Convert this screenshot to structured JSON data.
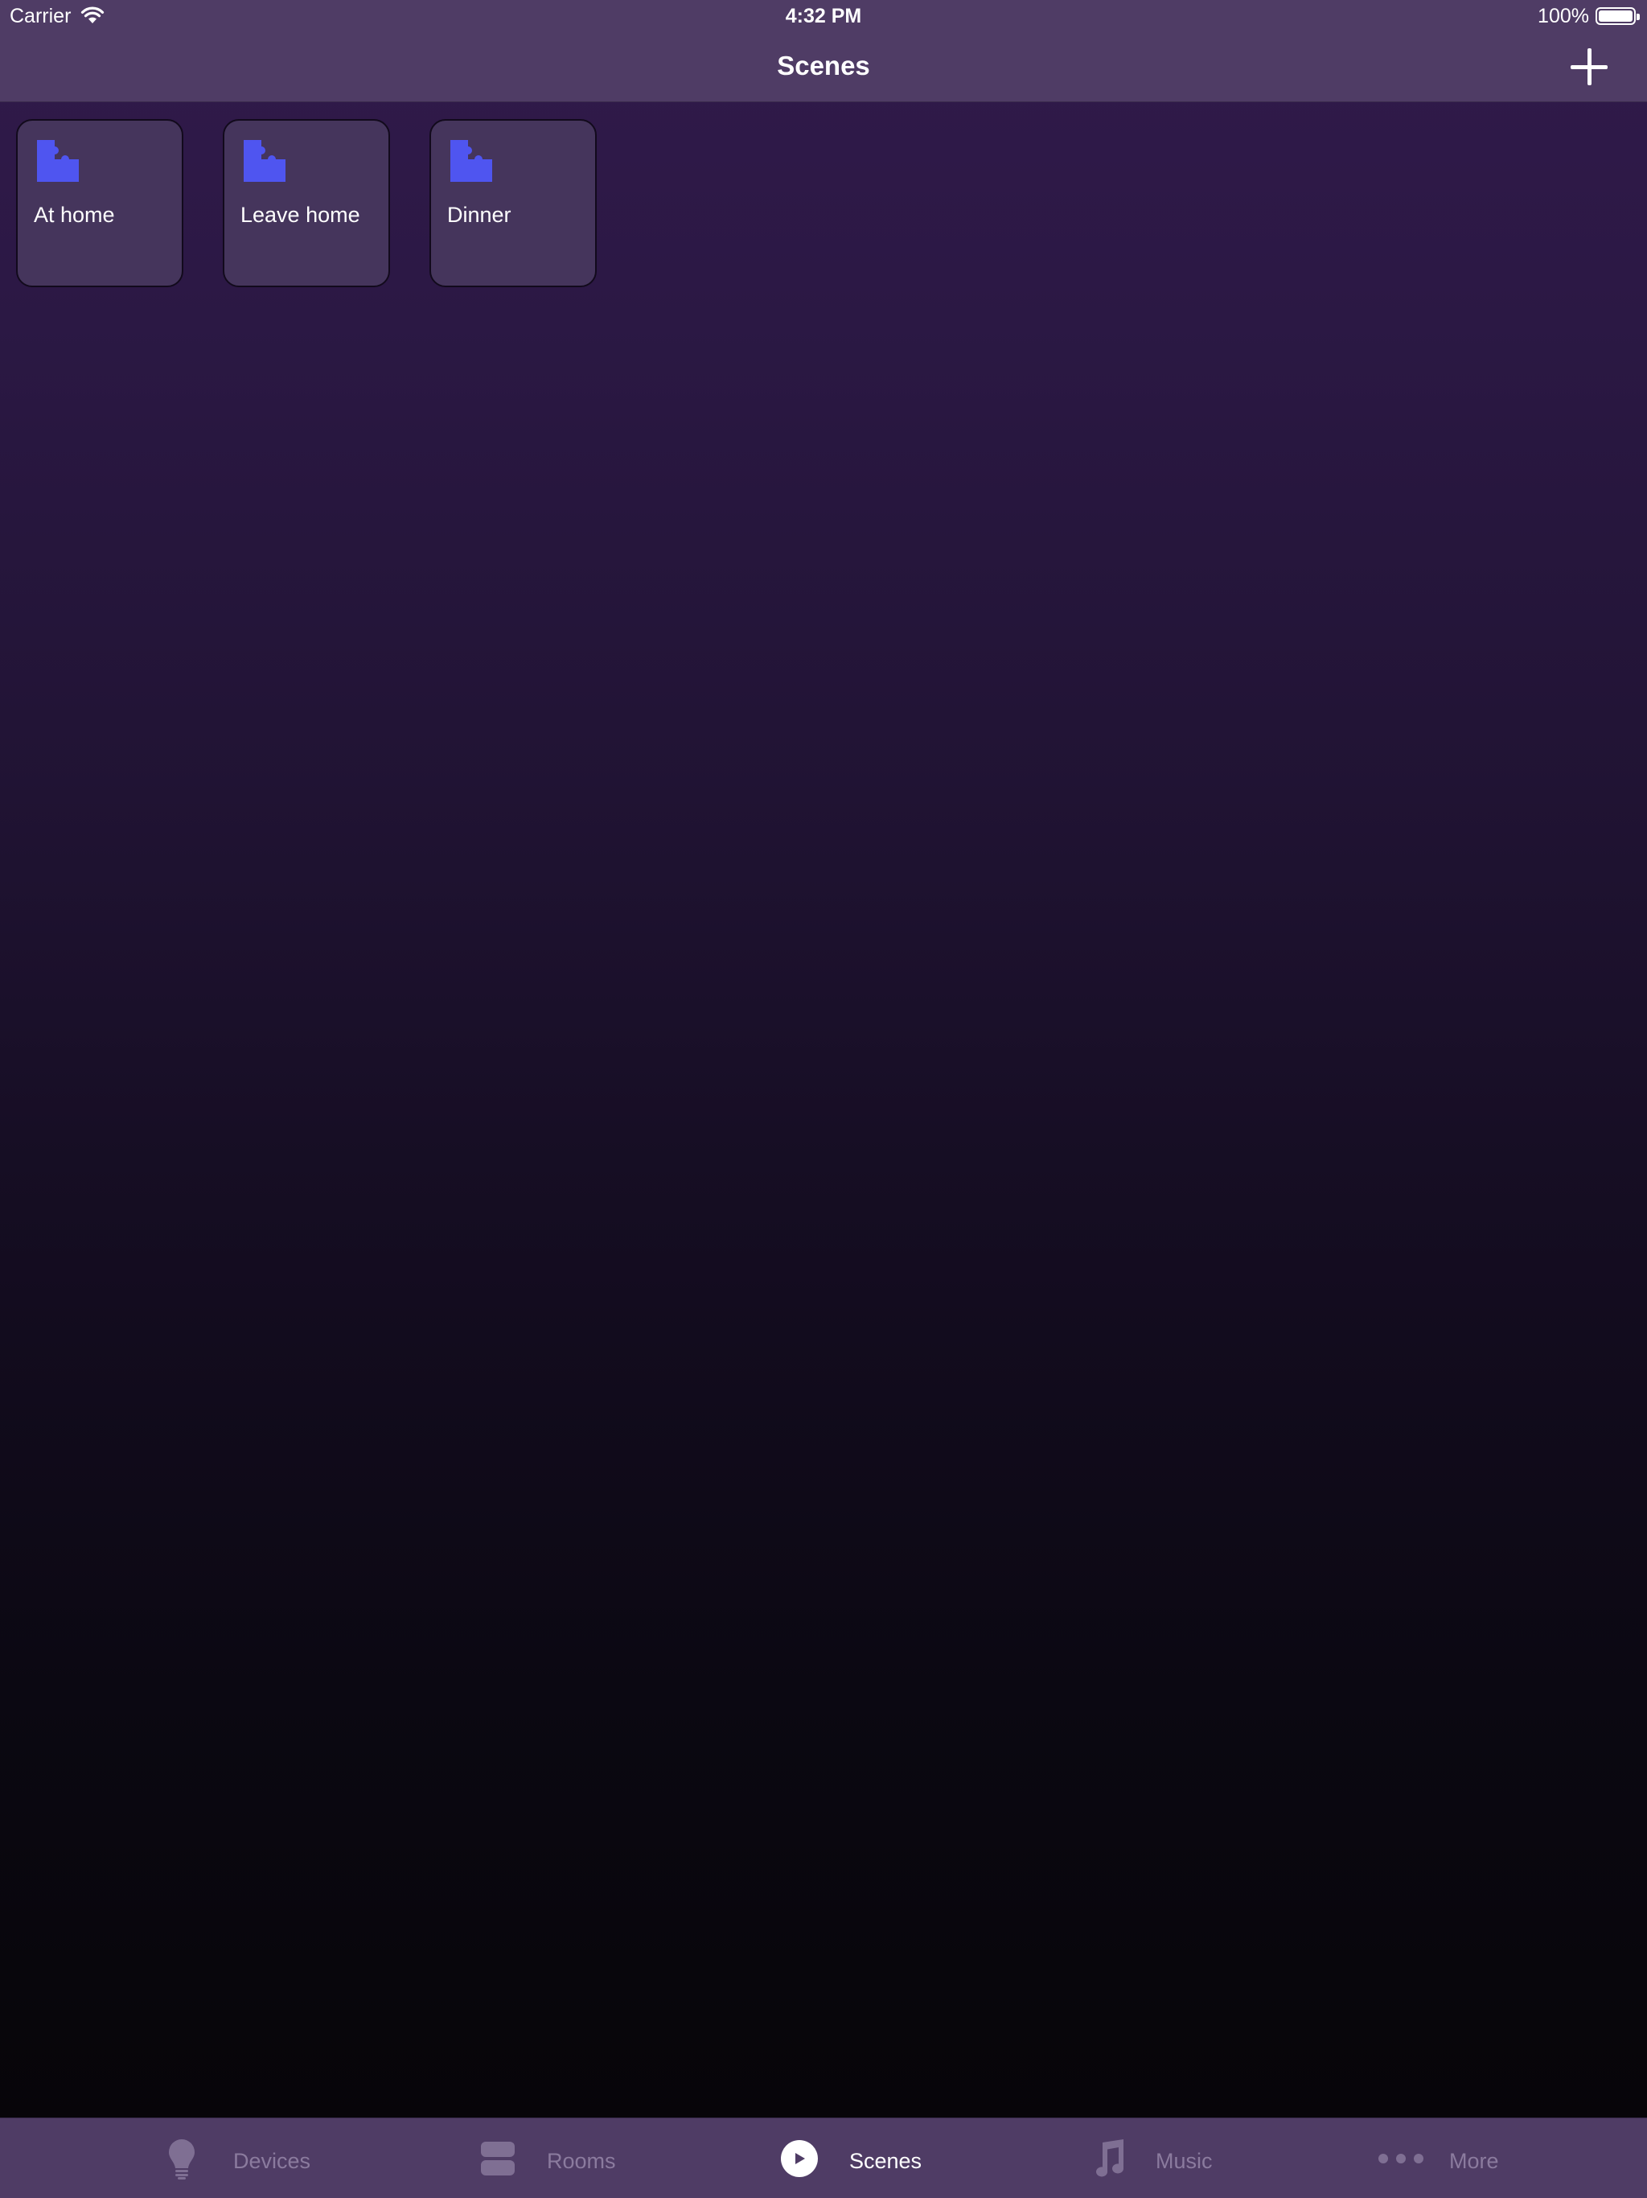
{
  "status_bar": {
    "carrier": "Carrier",
    "time": "4:32 PM",
    "battery_percent": "100%",
    "battery_level": 1.0
  },
  "nav_bar": {
    "title": "Scenes",
    "add_icon": "plus-icon"
  },
  "scenes": [
    {
      "label": "At home",
      "icon": "puzzle-icon"
    },
    {
      "label": "Leave home",
      "icon": "puzzle-icon"
    },
    {
      "label": "Dinner",
      "icon": "puzzle-icon"
    }
  ],
  "tab_bar": {
    "active": "Scenes",
    "tabs": [
      {
        "label": "Devices",
        "icon": "lightbulb-icon"
      },
      {
        "label": "Rooms",
        "icon": "rooms-icon"
      },
      {
        "label": "Scenes",
        "icon": "play-circle-icon"
      },
      {
        "label": "Music",
        "icon": "music-note-icon"
      },
      {
        "label": "More",
        "icon": "more-dots-icon"
      }
    ]
  },
  "colors": {
    "accent_icon": "#4f55f0",
    "bar_background": "#4f3c65",
    "tile_background": "#45355c",
    "inactive_tab": "#8b7b9e"
  }
}
